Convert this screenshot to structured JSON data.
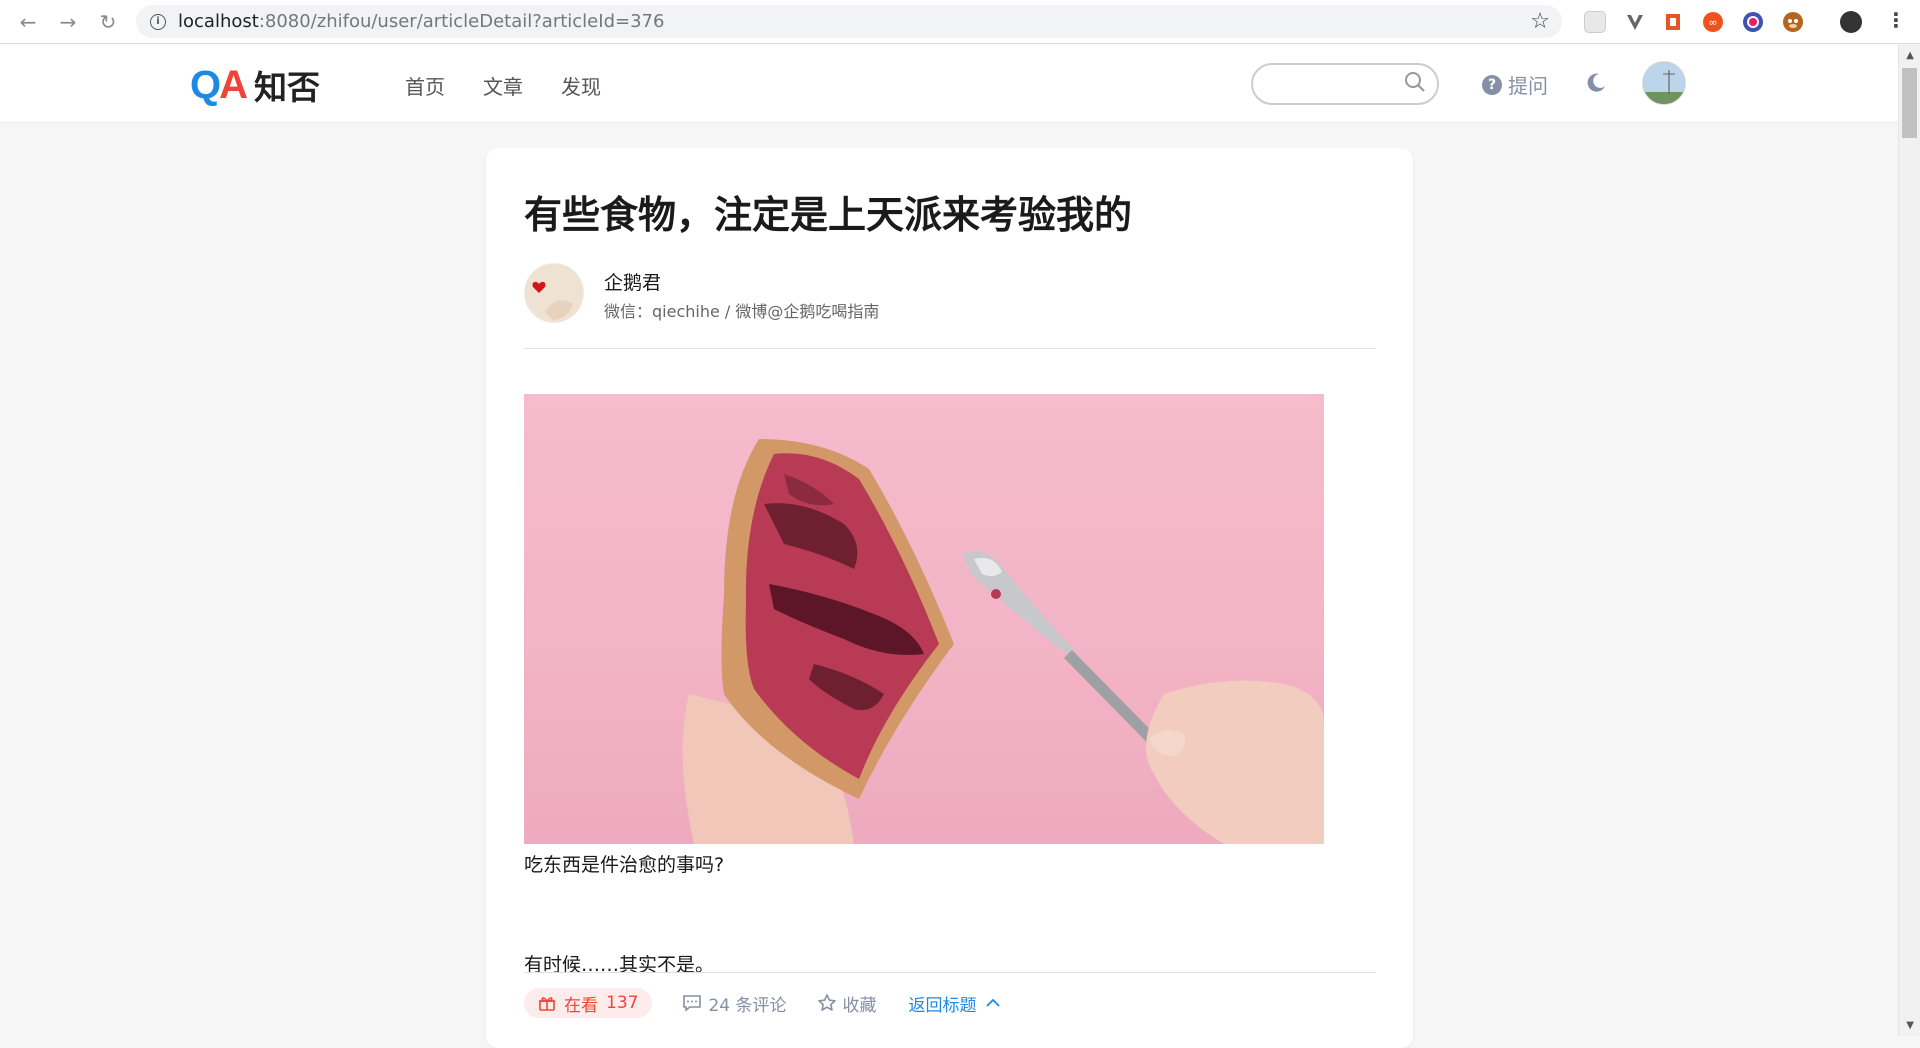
{
  "browser": {
    "url_host": "localhost",
    "url_path": ":8080/zhifou/user/articleDetail?articleId=376"
  },
  "header": {
    "logo_q": "Q",
    "logo_a": "A",
    "logo_text": "知否",
    "nav": [
      "首页",
      "文章",
      "发现"
    ],
    "search_placeholder": "",
    "ask_label": "提问"
  },
  "article": {
    "title": "有些食物，注定是上天派来考验我的",
    "author_name": "企鹅君",
    "author_bio": "微信：qiechihe / 微博@企鹅吃喝指南",
    "paragraphs": [
      "吃东西是件治愈的事吗?",
      "有时候……其实不是。"
    ]
  },
  "actions": {
    "watching_label": "在看",
    "watching_count": "137",
    "comments_label": "24 条评论",
    "favorite_label": "收藏",
    "back_label": "返回标题"
  },
  "colors": {
    "brand_blue": "#1e88e5",
    "brand_red": "#f0443a",
    "muted": "#8590a6"
  }
}
